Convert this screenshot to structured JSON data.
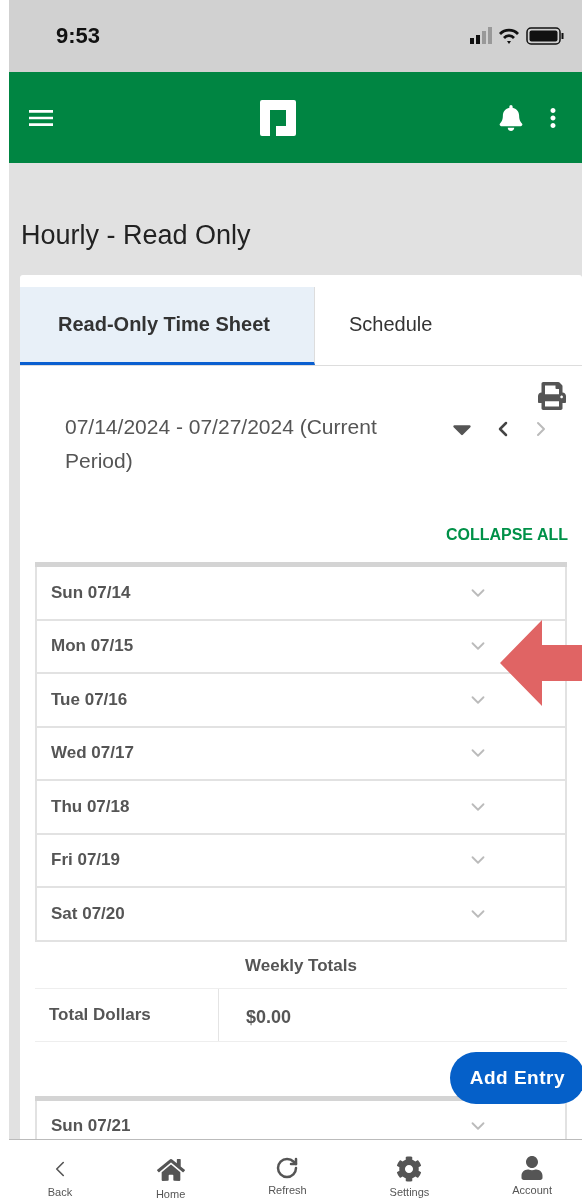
{
  "status_bar": {
    "time": "9:53"
  },
  "page_title": "Hourly - Read Only",
  "tabs": [
    {
      "label": "Read-Only Time Sheet",
      "selected": true
    },
    {
      "label": "Schedule",
      "selected": false
    }
  ],
  "period": {
    "label": "07/14/2024 - 07/27/2024 (Current Period)",
    "next_disabled": true
  },
  "collapse_all": "COLLAPSE ALL",
  "days": [
    {
      "label": "Sun 07/14",
      "expanded": false
    },
    {
      "label": "Mon 07/15",
      "expanded": false
    },
    {
      "label": "Tue 07/16",
      "expanded": false
    },
    {
      "label": "Wed 07/17",
      "expanded": false
    },
    {
      "label": "Thu 07/18",
      "expanded": false
    },
    {
      "label": "Fri 07/19",
      "expanded": false
    },
    {
      "label": "Sat 07/20",
      "expanded": false
    }
  ],
  "weekly_totals": {
    "title": "Weekly Totals",
    "rows": [
      {
        "label": "Total Dollars",
        "value": "$0.00"
      }
    ]
  },
  "add_entry": "Add Entry",
  "next_week_days": [
    {
      "label": "Sun 07/21",
      "expanded": false
    }
  ],
  "bottom_nav": [
    {
      "kind": "back",
      "label": "Back"
    },
    {
      "kind": "home",
      "label": "Home"
    },
    {
      "kind": "refresh",
      "label": "Refresh"
    },
    {
      "kind": "settings",
      "label": "Settings"
    },
    {
      "kind": "account",
      "label": "Account"
    }
  ]
}
